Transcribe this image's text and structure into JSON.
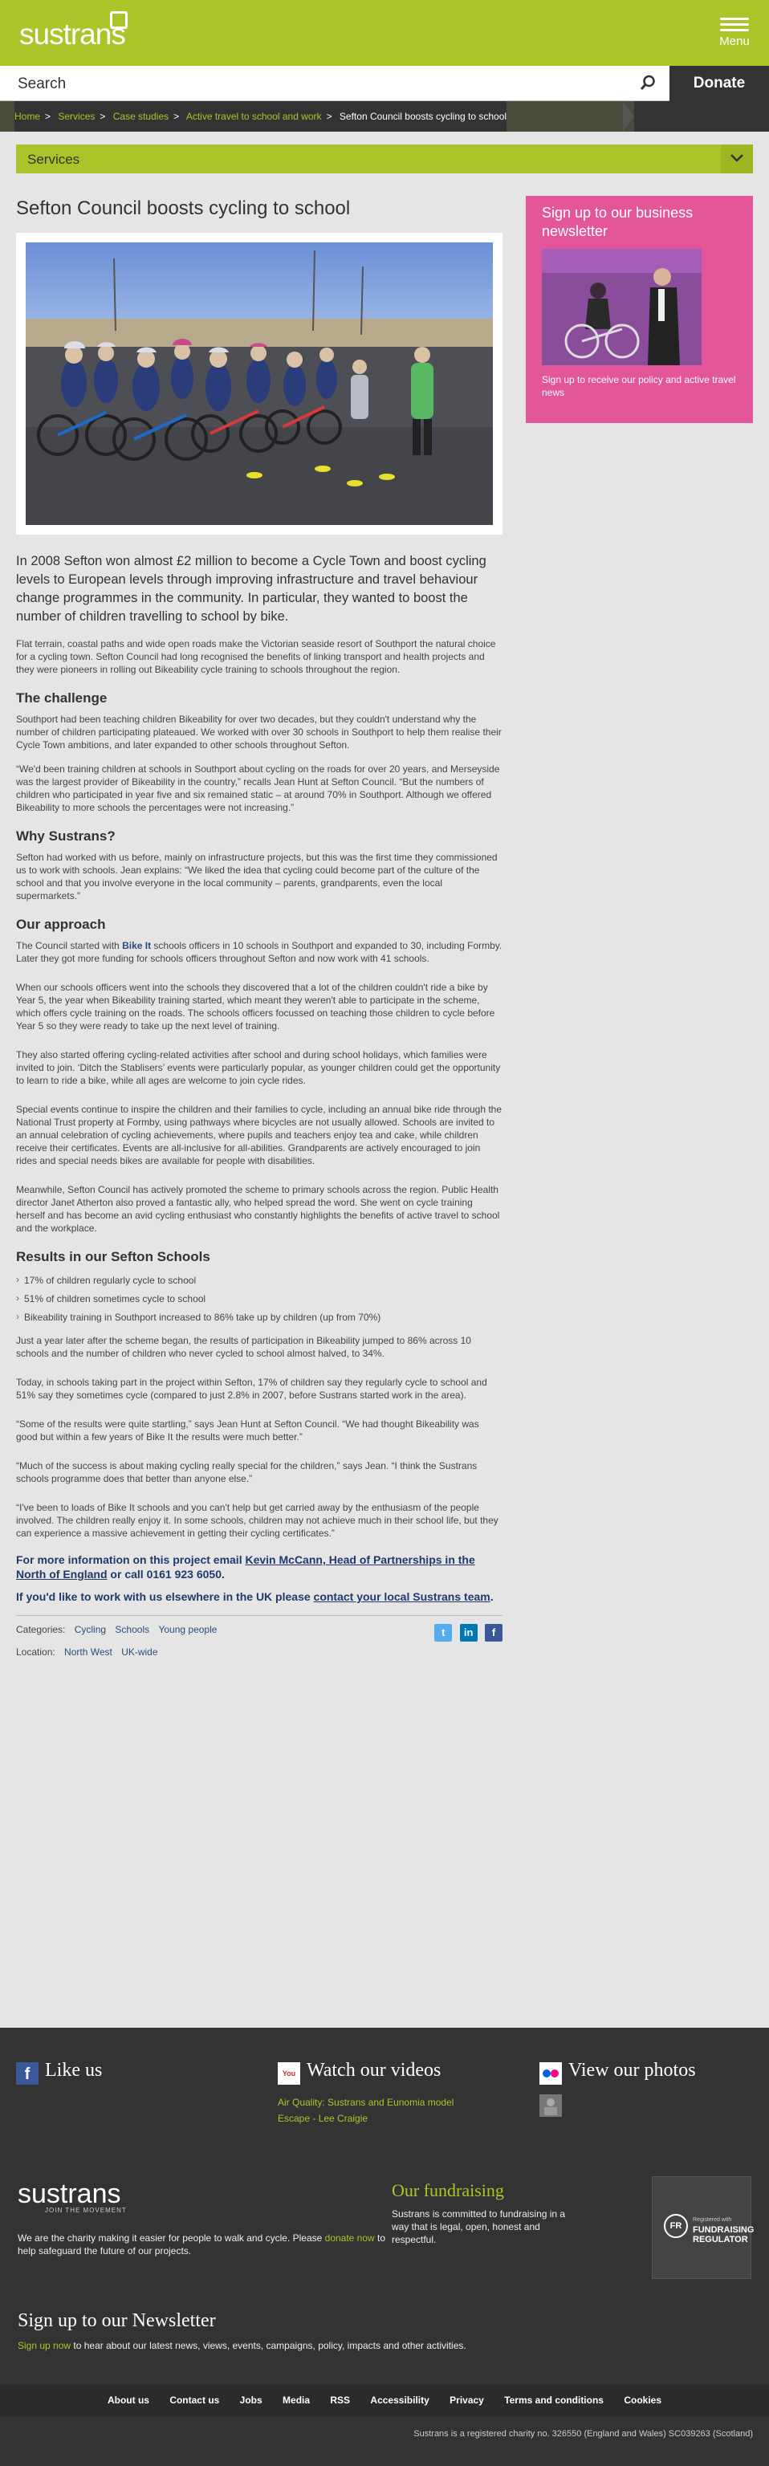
{
  "header": {
    "logo": "sustrans",
    "menu_label": "Menu",
    "search_placeholder": "Search",
    "donate_label": "Donate"
  },
  "breadcrumbs": [
    "Home",
    "Services",
    "Case studies",
    "Active travel to school and work",
    "Sefton Council boosts cycling to school"
  ],
  "services_label": "Services",
  "article": {
    "title": "Sefton Council boosts cycling to school",
    "lead": "In 2008 Sefton won almost £2 million to become a Cycle Town and boost cycling levels to European levels through improving infrastructure and travel behaviour change programmes in the community. In particular, they wanted to boost the number of children travelling to school by bike.",
    "intro": "Flat terrain, coastal paths and wide open roads make the Victorian seaside resort of Southport the natural choice for a cycling town. Sefton Council had long recognised the benefits of linking transport and health projects and they were pioneers in rolling out Bikeability cycle training to schools throughout the region.",
    "h_challenge": "The challenge",
    "challenge_1": "Southport had been teaching children Bikeability for over two decades, but they couldn't understand why the number of children participating plateaued. We worked with over 30 schools in Southport to help them realise their Cycle Town ambitions, and later expanded to other schools throughout Sefton.",
    "challenge_2": "“We'd been training children at schools in Southport about cycling on the roads for over 20 years, and Merseyside was the largest provider of Bikeability in the country,” recalls Jean Hunt at Sefton Council. “But the numbers of children who participated in year five and six remained static – at around 70% in Southport. Although we offered Bikeability to more schools the percentages were not increasing.”",
    "h_why": "Why Sustrans?",
    "why_1": "Sefton had worked with us before, mainly on infrastructure projects, but this was the first time they commissioned us to work with schools. Jean explains: “We liked the idea that cycling could become part of the culture of the school and that you involve everyone in the local community – parents, grandparents, even the local supermarkets.”",
    "h_approach": "Our approach",
    "approach_1a": "The Council started with ",
    "approach_1_link": "Bike It",
    "approach_1b": " schools officers in 10 schools in Southport and expanded to 30, including Formby. Later they got more funding for schools officers throughout Sefton and now work with 41 schools.",
    "approach_2": "When our schools officers went into the schools they discovered that a lot of the children couldn't ride a bike by Year 5, the year when Bikeability training started, which meant they weren't able to participate in the scheme, which offers cycle training on the roads. The schools officers focussed on teaching those children to cycle before Year 5 so they were ready to take up the next level of training.",
    "approach_3": "They also started offering cycling-related activities after school and during school holidays, which families were invited to join. ‘Ditch the Stablisers’ events were particularly popular, as younger children could get the opportunity to learn to ride a bike, while all ages are welcome to join cycle rides.",
    "approach_4": "Special events continue to inspire the children and their families to cycle, including an annual bike ride through the National Trust property at Formby, using pathways where bicycles are not usually allowed. Schools are invited to an annual celebration of cycling achievements, where pupils and teachers enjoy tea and cake, while children receive their certificates. Events are all-inclusive for all-abilities. Grandparents are actively encouraged to join rides and special needs bikes are available for people with disabilities.",
    "approach_5": "Meanwhile, Sefton Council has actively promoted the scheme to primary schools across the region. Public Health director Janet Atherton also proved a fantastic ally, who helped spread the word. She went on cycle training herself and has become an avid cycling enthusiast who constantly highlights the benefits of active travel to school and the workplace.",
    "h_results": "Results in our Sefton Schools",
    "results": [
      "17% of children regularly cycle to school",
      "51% of children sometimes cycle to school",
      "Bikeability training in Southport increased to 86% take up by children (up from 70%)"
    ],
    "results_1": "Just a year later after the scheme began, the results of participation in Bikeability jumped to 86% across 10 schools and the number of children who never cycled to school almost halved, to 34%.",
    "results_2": "Today, in schools taking part in the project within Sefton, 17% of children say they regularly cycle to school and 51% say they sometimes cycle (compared to just 2.8% in 2007, before Sustrans started work in the area).",
    "quote_1": "“Some of the results were quite startling,” says  Jean Hunt at Sefton Council. “We had thought Bikeability was good but within a few years of Bike It the results were much better.”",
    "quote_2": "“Much of the success is about making cycling really special for the children,” says Jean. “I think the Sustrans schools programme does that better than anyone else.”",
    "quote_3": "“I've been to loads of Bike It schools and you can't help but get carried away by the enthusiasm of the people involved. The children really enjoy it. In some schools, children may not achieve much in their school life, but they can experience a massive achievement in getting their cycling certificates.”",
    "cta_1a": "For more information on this project email ",
    "cta_1_link": "Kevin McCann, Head of Partnerships in the North of England",
    "cta_1b": " or call 0161 923 6050.",
    "cta_2a": "If you'd like to work with us elsewhere in the UK please ",
    "cta_2_link": "contact your local Sustrans team",
    "cta_2b": ".",
    "categories_label": "Categories:",
    "categories": [
      "Cycling",
      "Schools",
      "Young people"
    ],
    "location_label": "Location:",
    "locations": [
      "North West",
      "UK-wide"
    ]
  },
  "sidebar": {
    "title": "Sign up to our business newsletter",
    "link": "Sign up to receive our policy and active travel news"
  },
  "footer": {
    "like_us": "Like us",
    "watch_videos": "Watch our videos",
    "videos": [
      "Air Quality: Sustrans and Eunomia model",
      "Escape - Lee Craigie"
    ],
    "view_photos": "View our photos",
    "logo": "sustrans",
    "logo_tag": "JOIN THE MOVEMENT",
    "charity_text_a": "We are the charity making it easier for people to walk and cycle. Please ",
    "charity_link": "donate now",
    "charity_text_b": " to help safeguard the future of our projects.",
    "fundraising_title": "Our fundraising",
    "fundraising_text": "Sustrans is committed to fundraising in a way that is legal, open, honest and respectful.",
    "fr_badge": "FR",
    "fr_registered": "Registered with",
    "fr_regulator": "FUNDRAISING REGULATOR",
    "newsletter_title": "Sign up to our Newsletter",
    "newsletter_link": "Sign up now",
    "newsletter_text": " to hear about our latest news, views, events, campaigns, policy, impacts and other activities.",
    "nav": [
      "About us",
      "Contact us",
      "Jobs",
      "Media",
      "RSS",
      "Accessibility",
      "Privacy",
      "Terms and conditions",
      "Cookies"
    ],
    "registered": "Sustrans is a registered charity no. 326550 (England and Wales) SC039263 (Scotland)"
  },
  "colors": {
    "brand_green": "#acc42a",
    "dark": "#333333",
    "pink": "#e4569a",
    "link_blue": "#2a4d7c"
  }
}
